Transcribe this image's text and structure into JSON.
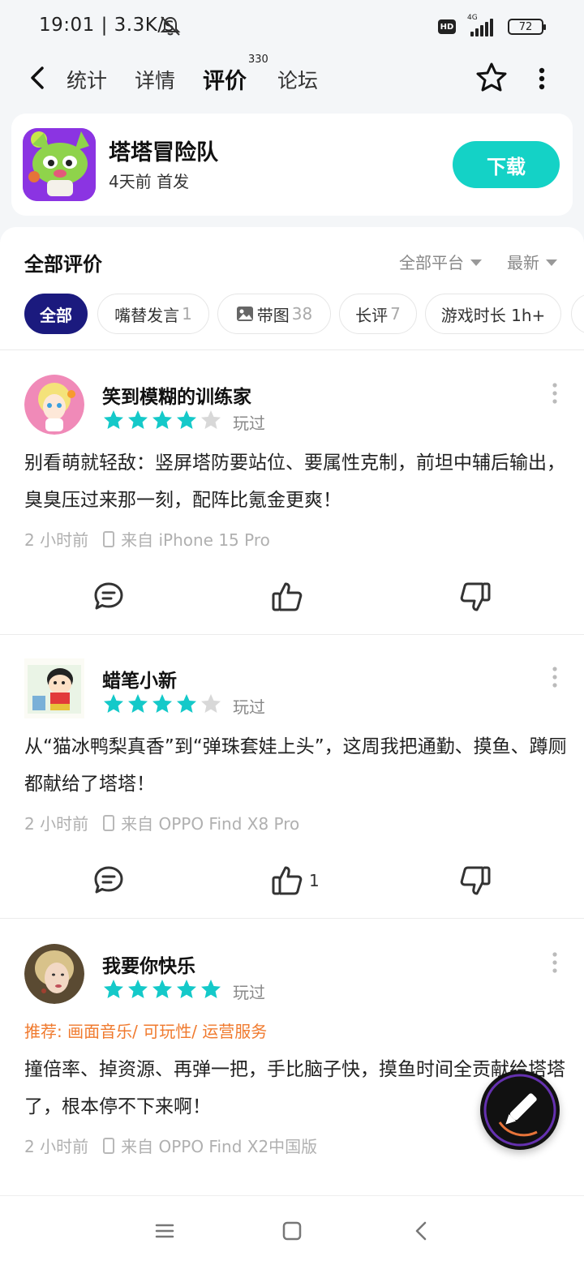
{
  "status": {
    "time": "19:01 | 3.3K/s",
    "hd": "HD",
    "network": "4G",
    "battery": "72"
  },
  "nav": {
    "tabs": [
      {
        "label": "统计"
      },
      {
        "label": "详情"
      },
      {
        "label": "评价",
        "badge": "330"
      },
      {
        "label": "论坛"
      }
    ],
    "active_tab": "评价"
  },
  "game": {
    "name": "塔塔冒险队",
    "subtitle": "4天前 首发",
    "download_label": "下载"
  },
  "reviews_header": {
    "title": "全部评价",
    "platform_filter": "全部平台",
    "sort": "最新"
  },
  "chips": [
    {
      "label": "全部",
      "count": ""
    },
    {
      "label": "嘴替发言",
      "count": "1"
    },
    {
      "label": "带图",
      "count": "38"
    },
    {
      "label": "长评",
      "count": "7"
    },
    {
      "label": "游戏时长 1h+",
      "count": ""
    }
  ],
  "reviews": [
    {
      "user": "笑到模糊的训练家",
      "rating": 4,
      "played": "玩过",
      "recommend": "",
      "text": "别看萌就轻敌：竖屏塔防要站位、要属性克制，前坦中辅后输出，臭臭压过来那一刻，配阵比氪金更爽！",
      "time": "2 小时前",
      "device": "来自 iPhone 15 Pro",
      "likes": ""
    },
    {
      "user": "蜡笔小新",
      "rating": 4,
      "played": "玩过",
      "recommend": "",
      "text": "从“猫冰鸭梨真香”到“弹珠套娃上头”，这周我把通勤、摸鱼、蹲厕都献给了塔塔！",
      "time": "2 小时前",
      "device": "来自 OPPO Find X8 Pro",
      "likes": "1"
    },
    {
      "user": "我要你快乐",
      "rating": 5,
      "played": "玩过",
      "recommend": "推荐: 画面音乐/ 可玩性/ 运营服务",
      "text": "撞倍率、掉资源、再弹一把，手比脑子快，摸鱼时间全贡献给塔塔了，根本停不下来啊！",
      "time": "2 小时前",
      "device": "来自 OPPO Find X2中国版",
      "likes": ""
    }
  ],
  "colors": {
    "accent": "#14c9c9",
    "download": "#14d2c6",
    "chip_active": "#1b1a7e",
    "star_on": "#14c9c9",
    "star_off": "#d8d8d8",
    "recommend": "#f07a2e"
  },
  "icons": [
    "back-icon",
    "star-outline-icon",
    "more-vertical-icon",
    "comment-icon",
    "thumbs-up-icon",
    "thumbs-down-icon",
    "image-icon",
    "pen-icon",
    "mute-bell-icon",
    "menu-icon",
    "home-square-icon",
    "back-chevron-icon"
  ]
}
